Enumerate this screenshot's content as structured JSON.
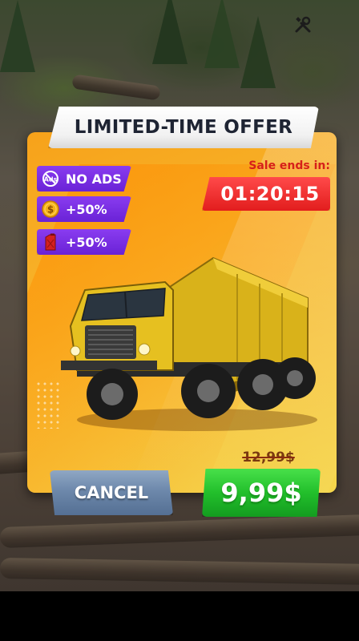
{
  "offer": {
    "title": "LIMITED-TIME OFFER",
    "perks": [
      {
        "icon": "no-ads-icon",
        "label": "NO ADS"
      },
      {
        "icon": "coin-icon",
        "label": "+50%"
      },
      {
        "icon": "fuel-can-icon",
        "label": "+50%"
      }
    ],
    "sale_label": "Sale ends in:",
    "timer": "01:20:15",
    "item_image": "dump-truck",
    "old_price": "12,99$",
    "new_price": "9,99$",
    "cancel_label": "CANCEL"
  },
  "hud": {
    "tools_icon": "wrench-screwdriver-icon"
  },
  "colors": {
    "card": "#f7b42a",
    "perk": "#7a2ee6",
    "timer": "#e21d1d",
    "buy": "#22bf2b",
    "cancel": "#6d88ab"
  }
}
